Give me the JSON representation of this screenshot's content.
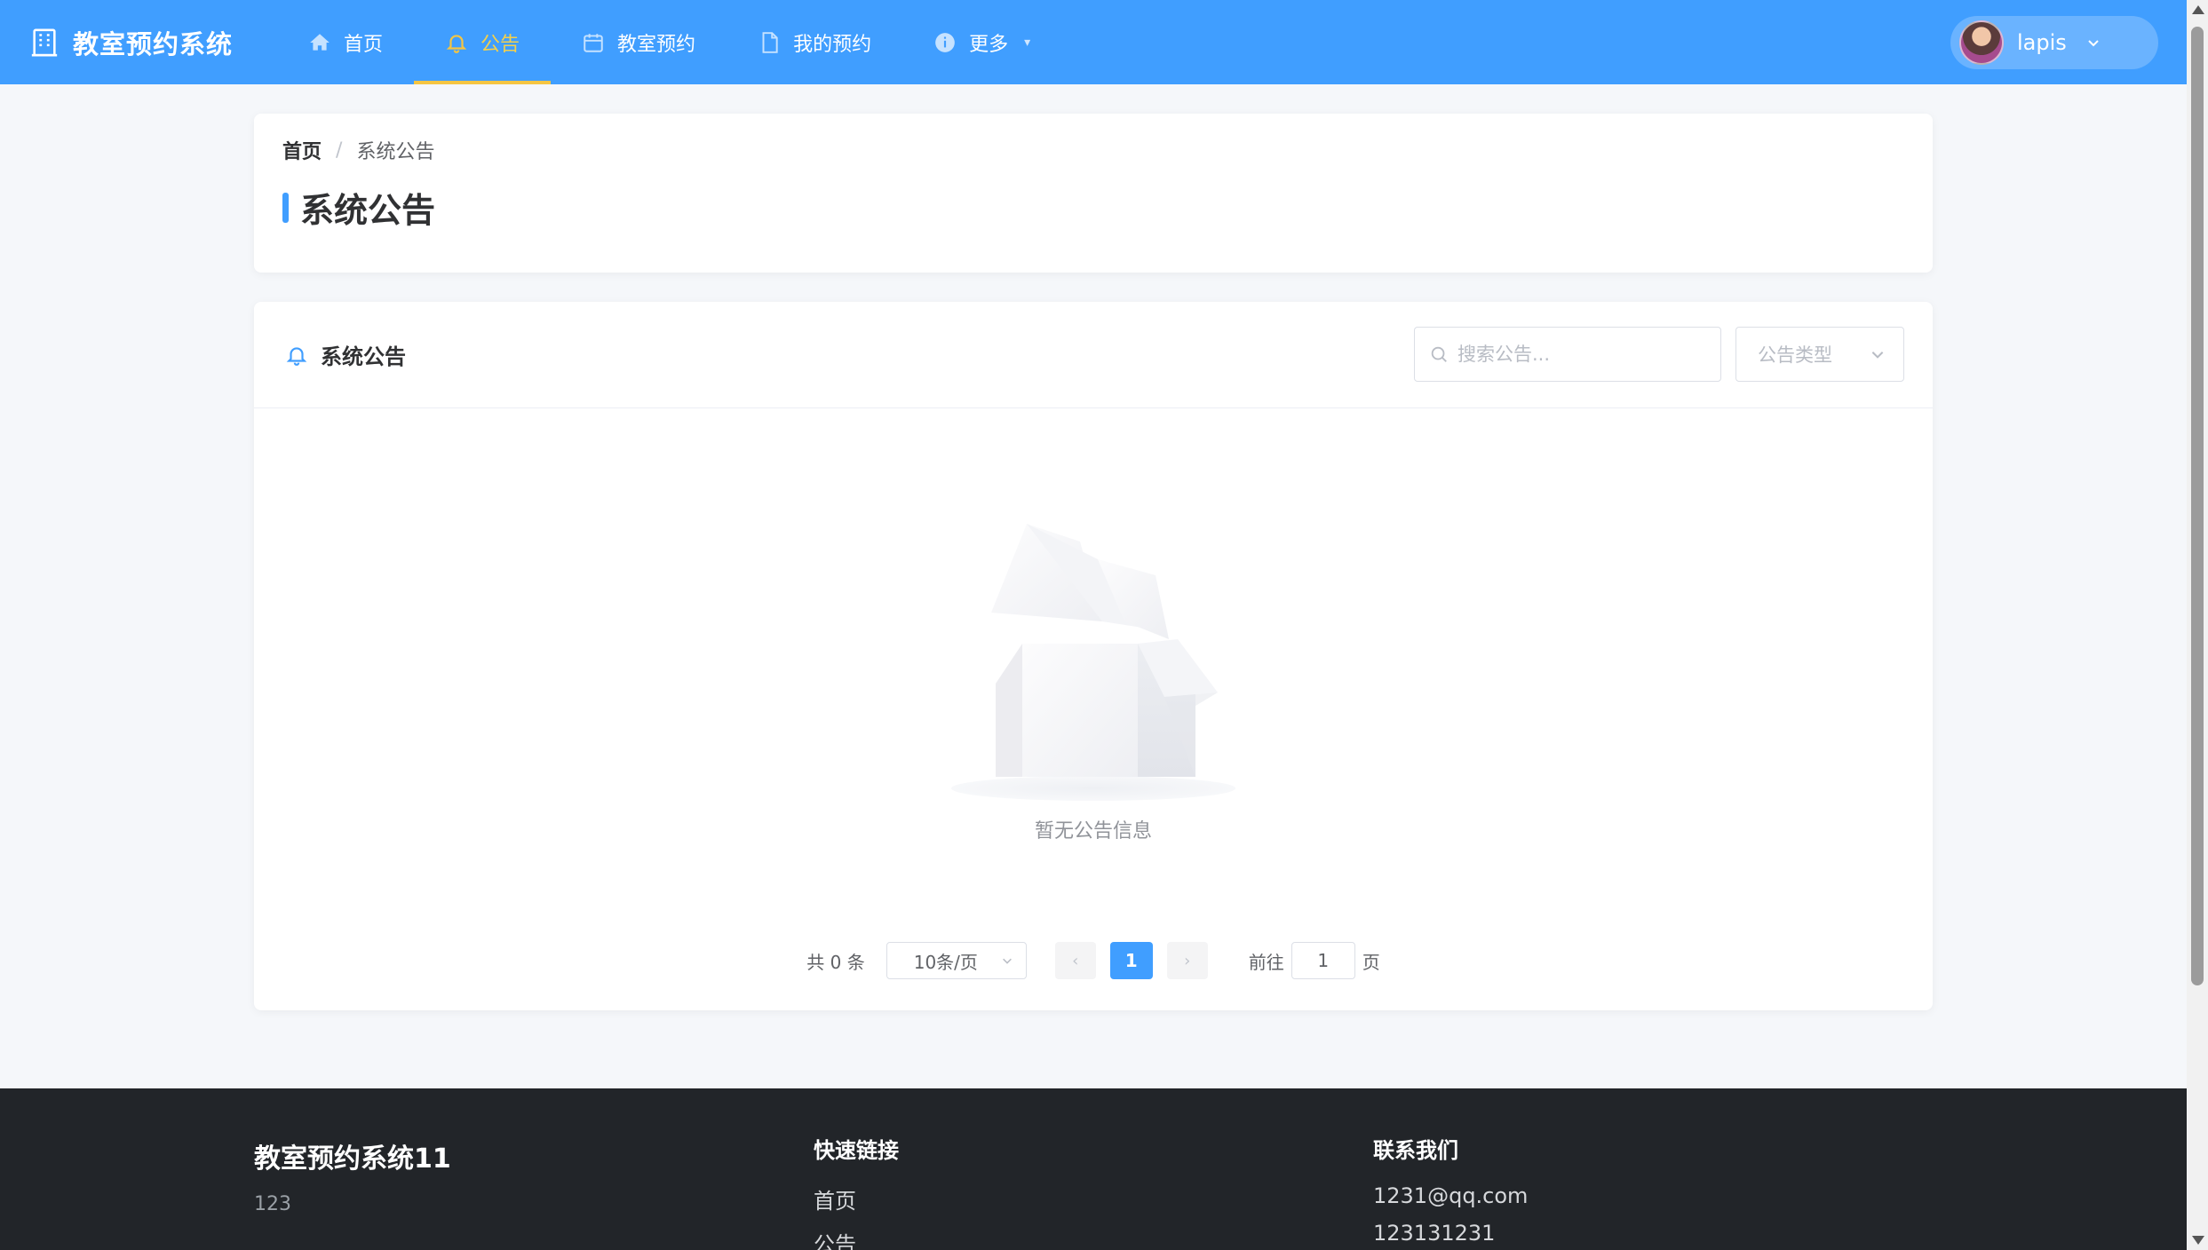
{
  "header": {
    "brand": "教室预约系统",
    "nav": [
      {
        "label": "首页",
        "icon": "home-icon"
      },
      {
        "label": "公告",
        "icon": "bell-icon",
        "active": true
      },
      {
        "label": "教室预约",
        "icon": "calendar-icon"
      },
      {
        "label": "我的预约",
        "icon": "document-icon"
      },
      {
        "label": "更多",
        "icon": "info-icon"
      }
    ],
    "user": {
      "name": "lapis"
    }
  },
  "title_card": {
    "breadcrumb_home": "首页",
    "breadcrumb_sep": "/",
    "breadcrumb_current": "系统公告",
    "title": "系统公告"
  },
  "list_card": {
    "title": "系统公告",
    "search_placeholder": "搜索公告...",
    "type_placeholder": "公告类型",
    "empty_text": "暂无公告信息"
  },
  "pagination": {
    "total": "共 0 条",
    "page_size": "10条/页",
    "current_page": "1",
    "goto_label": "前往",
    "goto_value": "1",
    "page_unit": "页"
  },
  "footer": {
    "brand": "教室预约系统11",
    "desc": "123",
    "links_heading": "快速链接",
    "links": [
      "首页",
      "公告"
    ],
    "contact_heading": "联系我们",
    "contacts": [
      "1231@qq.com",
      "123131231"
    ]
  },
  "colors": {
    "primary": "#409eff",
    "active_nav": "#f5c542",
    "footer_bg": "#222529",
    "page_bg": "#f5f7fa"
  }
}
